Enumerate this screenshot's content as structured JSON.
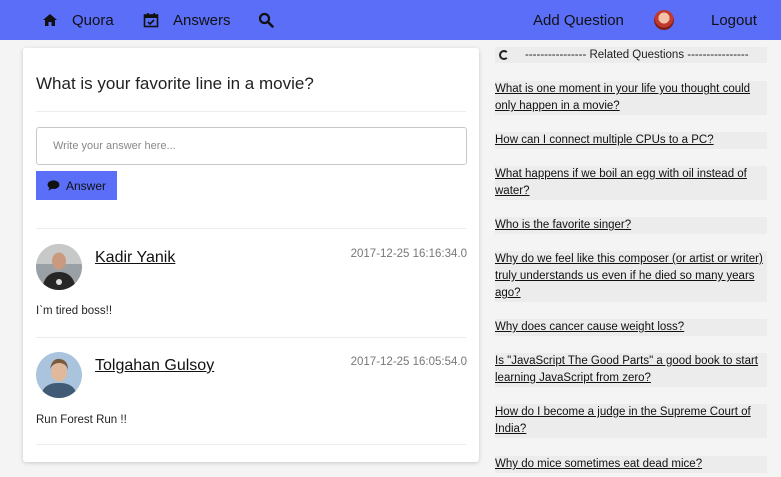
{
  "navbar": {
    "brand_label": "Quora",
    "brand_icon": "home-icon",
    "answers_label": "Answers",
    "answers_icon": "calendar-check-icon",
    "search_icon": "search-icon",
    "add_question_label": "Add Question",
    "logout_label": "Logout",
    "accent_color": "#5a6ef8"
  },
  "question": {
    "title": "What is your favorite line in a movie?",
    "answer_placeholder": "Write your answer here...",
    "answer_button_label": "Answer"
  },
  "answers": [
    {
      "author": "Kadir Yanik",
      "date": "2017-12-25 16:16:34.0",
      "text": "I`m tired boss!!"
    },
    {
      "author": "Tolgahan Gulsoy",
      "date": "2017-12-25 16:05:54.0",
      "text": "Run Forest Run !!"
    }
  ],
  "related": {
    "header": "---------------- Related Questions ----------------",
    "items": [
      "What is one moment in your life you thought could only happen in a movie?",
      "How can I connect multiple CPUs to a PC?",
      "What happens if we boil an egg with oil instead of water?",
      "Who is the favorite singer?",
      "Why do we feel like this composer (or artist or writer) truly understands us even if he died so many years ago?",
      "Why does cancer cause weight loss?",
      "Is \"JavaScript The Good Parts\" a good book to start learning JavaScript from zero?",
      "How do I become a judge in the Supreme Court of India?",
      "Why do mice sometimes eat dead mice?"
    ]
  }
}
